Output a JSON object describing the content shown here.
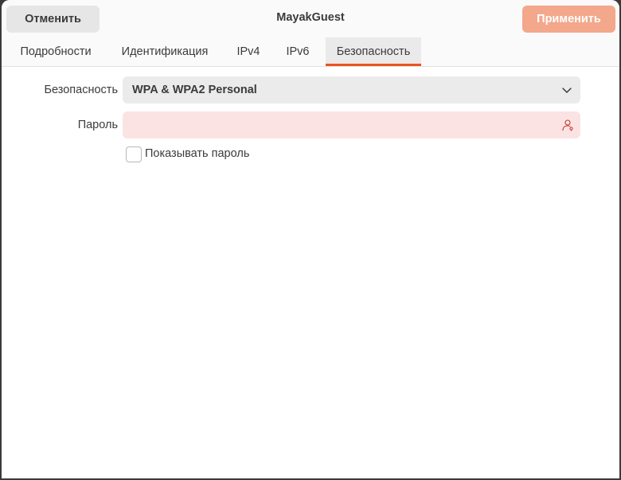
{
  "header": {
    "title": "MayakGuest",
    "cancel_label": "Отменить",
    "apply_label": "Применить"
  },
  "tabs": [
    {
      "label": "Подробности",
      "active": false
    },
    {
      "label": "Идентификация",
      "active": false
    },
    {
      "label": "IPv4",
      "active": false
    },
    {
      "label": "IPv6",
      "active": false
    },
    {
      "label": "Безопасность",
      "active": true
    }
  ],
  "security": {
    "label": "Безопасность",
    "selected_value": "WPA & WPA2 Personal"
  },
  "password": {
    "label": "Пароль",
    "value": "",
    "icon": "user-key-icon"
  },
  "show_password": {
    "label": "Показывать пароль",
    "checked": false
  },
  "colors": {
    "accent": "#e95420",
    "apply_button": "#f3a78b",
    "password_error_bg": "#fbe3e3",
    "password_icon": "#c0392b"
  }
}
